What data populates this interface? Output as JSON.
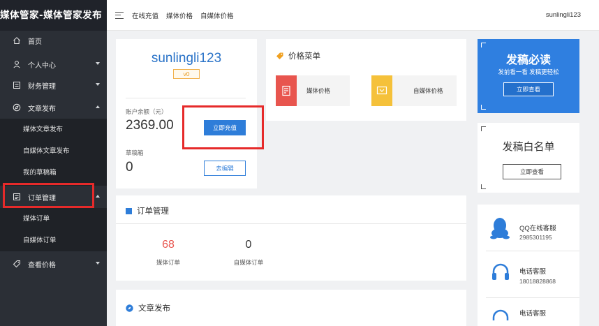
{
  "brand": "媒体管家-媒体管家发布",
  "topbar": {
    "links": [
      "在线充值",
      "媒体价格",
      "自媒体价格"
    ],
    "user": "sunlingli123"
  },
  "sidebar": {
    "items": [
      {
        "label": "首页",
        "icon": "home-icon"
      },
      {
        "label": "个人中心",
        "icon": "user-icon"
      },
      {
        "label": "财务管理",
        "icon": "finance-icon"
      },
      {
        "label": "文章发布",
        "icon": "compass-icon"
      },
      {
        "label": "订单管理",
        "icon": "order-icon"
      },
      {
        "label": "查看价格",
        "icon": "tag-icon"
      }
    ],
    "article_sub": [
      "媒体文章发布",
      "自媒体文章发布",
      "我的草稿箱"
    ],
    "order_sub": [
      "媒体订单",
      "自媒体订单"
    ]
  },
  "account": {
    "username": "sunlingli123",
    "level": "v0",
    "balance_label": "账户余额（元）",
    "balance": "2369.00",
    "recharge_button": "立即充值",
    "draft_label": "草稿箱",
    "draft_count": "0",
    "edit_button": "去编辑"
  },
  "price_menu": {
    "title": "价格菜单",
    "items": [
      "媒体价格",
      "自媒体价格"
    ]
  },
  "orders": {
    "title": "订单管理",
    "media_count": "68",
    "media_label": "媒体订单",
    "self_media_count": "0",
    "self_media_label": "自媒体订单"
  },
  "article": {
    "title": "文章发布"
  },
  "promo_must_read": {
    "title": "发稿必读",
    "subtitle": "发前看一看 发稿更轻松",
    "button": "立即查看"
  },
  "promo_whitelist": {
    "title": "发稿白名单",
    "button": "立即查看"
  },
  "services": [
    {
      "title": "QQ在线客服",
      "value": "2985301195"
    },
    {
      "title": "电话客服",
      "value": "18018828868"
    },
    {
      "title": "电话客服",
      "value": ""
    }
  ],
  "colors": {
    "sidebar": "#2b2f36",
    "accent": "#2e7dd9",
    "highlight": "#e62a2a",
    "order_count": "#e8554e"
  }
}
